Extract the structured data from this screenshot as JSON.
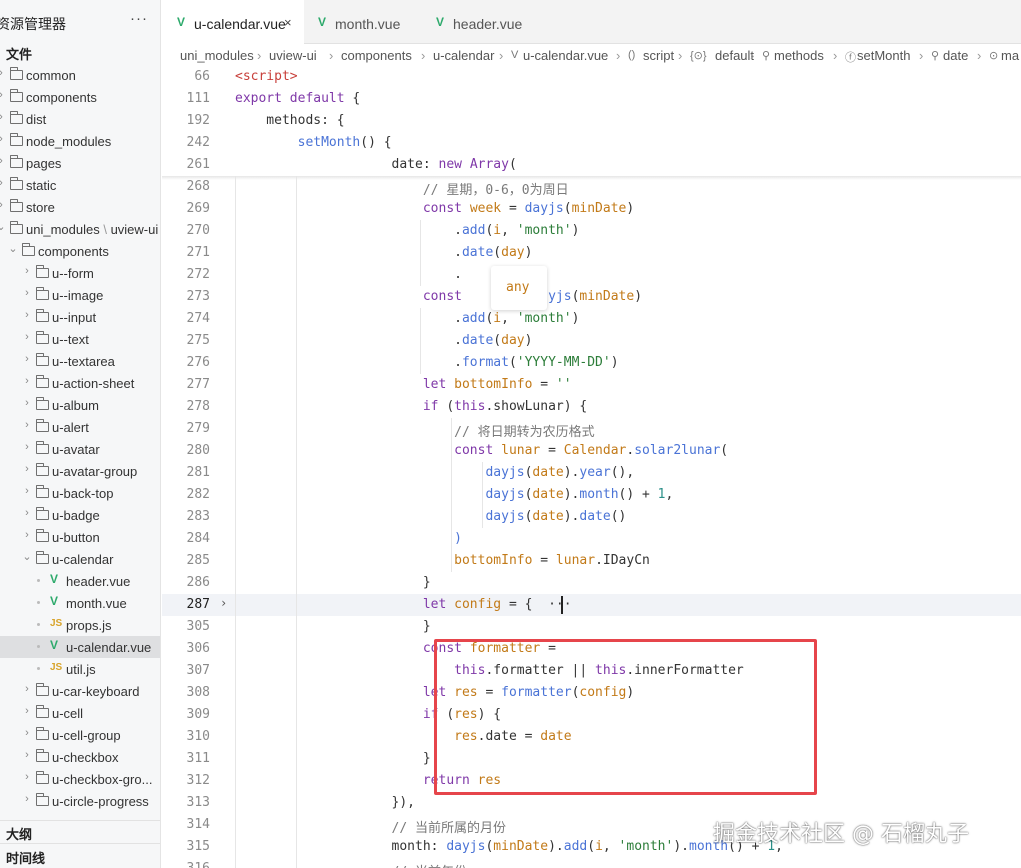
{
  "sidebar": {
    "title": "资源管理器",
    "more": "···",
    "section_files": "文件",
    "items": [
      {
        "label": "common",
        "depth": 0,
        "type": "folder"
      },
      {
        "label": "components",
        "depth": 0,
        "type": "folder"
      },
      {
        "label": "dist",
        "depth": 0,
        "type": "folder"
      },
      {
        "label": "node_modules",
        "depth": 0,
        "type": "folder"
      },
      {
        "label": "pages",
        "depth": 0,
        "type": "folder"
      },
      {
        "label": "static",
        "depth": 0,
        "type": "folder"
      },
      {
        "label": "store",
        "depth": 0,
        "type": "folder"
      },
      {
        "label": "uni_modules",
        "label2": "uview-ui",
        "depth": 0,
        "type": "folder-open"
      },
      {
        "label": "components",
        "depth": 1,
        "type": "folder-open"
      },
      {
        "label": "u--form",
        "depth": 2,
        "type": "folder"
      },
      {
        "label": "u--image",
        "depth": 2,
        "type": "folder"
      },
      {
        "label": "u--input",
        "depth": 2,
        "type": "folder"
      },
      {
        "label": "u--text",
        "depth": 2,
        "type": "folder"
      },
      {
        "label": "u--textarea",
        "depth": 2,
        "type": "folder"
      },
      {
        "label": "u-action-sheet",
        "depth": 2,
        "type": "folder"
      },
      {
        "label": "u-album",
        "depth": 2,
        "type": "folder"
      },
      {
        "label": "u-alert",
        "depth": 2,
        "type": "folder"
      },
      {
        "label": "u-avatar",
        "depth": 2,
        "type": "folder"
      },
      {
        "label": "u-avatar-group",
        "depth": 2,
        "type": "folder"
      },
      {
        "label": "u-back-top",
        "depth": 2,
        "type": "folder"
      },
      {
        "label": "u-badge",
        "depth": 2,
        "type": "folder"
      },
      {
        "label": "u-button",
        "depth": 2,
        "type": "folder"
      },
      {
        "label": "u-calendar",
        "depth": 2,
        "type": "folder-open"
      },
      {
        "label": "header.vue",
        "depth": 3,
        "type": "vue"
      },
      {
        "label": "month.vue",
        "depth": 3,
        "type": "vue"
      },
      {
        "label": "props.js",
        "depth": 3,
        "type": "js"
      },
      {
        "label": "u-calendar.vue",
        "depth": 3,
        "type": "vue",
        "selected": true
      },
      {
        "label": "util.js",
        "depth": 3,
        "type": "js"
      },
      {
        "label": "u-car-keyboard",
        "depth": 2,
        "type": "folder"
      },
      {
        "label": "u-cell",
        "depth": 2,
        "type": "folder"
      },
      {
        "label": "u-cell-group",
        "depth": 2,
        "type": "folder"
      },
      {
        "label": "u-checkbox",
        "depth": 2,
        "type": "folder"
      },
      {
        "label": "u-checkbox-gro...",
        "depth": 2,
        "type": "folder"
      },
      {
        "label": "u-circle-progress",
        "depth": 2,
        "type": "folder"
      }
    ],
    "outline_label": "大纲",
    "timeline_label": "时间线"
  },
  "tabs": [
    {
      "label": "u-calendar.vue",
      "active": true,
      "close": "×"
    },
    {
      "label": "month.vue",
      "active": false
    },
    {
      "label": "header.vue",
      "active": false
    }
  ],
  "breadcrumb": {
    "parts": [
      "uni_modules",
      "uview-ui",
      "components",
      "u-calendar",
      "u-calendar.vue",
      "script",
      "default",
      "methods",
      "setMonth",
      "date",
      "ma"
    ],
    "icons": [
      "",
      "",
      "",
      "",
      "V",
      "()",
      "{⊙}",
      "⚲",
      "ⓕ",
      "⚲",
      "⊙"
    ]
  },
  "code": {
    "hover_type": "any",
    "lines": [
      {
        "num": "66",
        "tokens": [
          [
            "t",
            "<script>"
          ]
        ]
      },
      {
        "num": "111",
        "tokens": [
          [
            "k",
            "export"
          ],
          [
            "p",
            " "
          ],
          [
            "k",
            "default"
          ],
          [
            "p",
            " {"
          ]
        ]
      },
      {
        "num": "192",
        "tokens": [
          [
            "p",
            "    methods: {"
          ]
        ]
      },
      {
        "num": "242",
        "tokens": [
          [
            "p",
            "        "
          ],
          [
            "f",
            "setMonth"
          ],
          [
            "p",
            "() {"
          ]
        ]
      },
      {
        "num": "261",
        "tokens": [
          [
            "p",
            "                    date: "
          ],
          [
            "k",
            "new"
          ],
          [
            "p",
            " "
          ],
          [
            "k",
            "Array"
          ],
          [
            "p",
            "("
          ]
        ]
      },
      {
        "num": "268",
        "tokens": [
          [
            "p",
            "                        "
          ],
          [
            "c",
            "// 星期，0-6，0为周日"
          ]
        ]
      },
      {
        "num": "269",
        "tokens": [
          [
            "p",
            "                        "
          ],
          [
            "k",
            "const"
          ],
          [
            "p",
            " "
          ],
          [
            "v",
            "week"
          ],
          [
            "p",
            " = "
          ],
          [
            "f",
            "dayjs"
          ],
          [
            "p",
            "("
          ],
          [
            "v",
            "minDate"
          ],
          [
            "p",
            ")"
          ]
        ]
      },
      {
        "num": "270",
        "tokens": [
          [
            "p",
            "                            ."
          ],
          [
            "f",
            "add"
          ],
          [
            "p",
            "("
          ],
          [
            "v",
            "i"
          ],
          [
            "p",
            ", "
          ],
          [
            "s",
            "'month'"
          ],
          [
            "p",
            ")"
          ]
        ]
      },
      {
        "num": "271",
        "tokens": [
          [
            "p",
            "                            ."
          ],
          [
            "f",
            "date"
          ],
          [
            "p",
            "("
          ],
          [
            "v",
            "day"
          ],
          [
            "p",
            ")"
          ]
        ]
      },
      {
        "num": "272",
        "tokens": [
          [
            "p",
            "                            ."
          ]
        ]
      },
      {
        "num": "273",
        "tokens": [
          [
            "p",
            "                        "
          ],
          [
            "k",
            "const"
          ],
          [
            "p",
            "         "
          ],
          [
            "f",
            "dayjs"
          ],
          [
            "p",
            "("
          ],
          [
            "v",
            "minDate"
          ],
          [
            "p",
            ")"
          ]
        ]
      },
      {
        "num": "274",
        "tokens": [
          [
            "p",
            "                            ."
          ],
          [
            "f",
            "add"
          ],
          [
            "p",
            "("
          ],
          [
            "v",
            "i"
          ],
          [
            "p",
            ", "
          ],
          [
            "s",
            "'month'"
          ],
          [
            "p",
            ")"
          ]
        ]
      },
      {
        "num": "275",
        "tokens": [
          [
            "p",
            "                            ."
          ],
          [
            "f",
            "date"
          ],
          [
            "p",
            "("
          ],
          [
            "v",
            "day"
          ],
          [
            "p",
            ")"
          ]
        ]
      },
      {
        "num": "276",
        "tokens": [
          [
            "p",
            "                            ."
          ],
          [
            "f",
            "format"
          ],
          [
            "p",
            "("
          ],
          [
            "s",
            "'YYYY-MM-DD'"
          ],
          [
            "p",
            ")"
          ]
        ]
      },
      {
        "num": "277",
        "tokens": [
          [
            "p",
            "                        "
          ],
          [
            "k",
            "let"
          ],
          [
            "p",
            " "
          ],
          [
            "v",
            "bottomInfo"
          ],
          [
            "p",
            " = "
          ],
          [
            "s",
            "''"
          ]
        ]
      },
      {
        "num": "278",
        "tokens": [
          [
            "p",
            "                        "
          ],
          [
            "k",
            "if"
          ],
          [
            "p",
            " ("
          ],
          [
            "k",
            "this"
          ],
          [
            "p",
            ".showLunar) {"
          ]
        ]
      },
      {
        "num": "279",
        "tokens": [
          [
            "p",
            "                            "
          ],
          [
            "c",
            "// 将日期转为农历格式"
          ]
        ]
      },
      {
        "num": "280",
        "tokens": [
          [
            "p",
            "                            "
          ],
          [
            "k",
            "const"
          ],
          [
            "p",
            " "
          ],
          [
            "v",
            "lunar"
          ],
          [
            "p",
            " = "
          ],
          [
            "v",
            "Calendar"
          ],
          [
            "p",
            "."
          ],
          [
            "f",
            "solar2lunar"
          ],
          [
            "p",
            "("
          ]
        ]
      },
      {
        "num": "281",
        "tokens": [
          [
            "p",
            "                                "
          ],
          [
            "f",
            "dayjs"
          ],
          [
            "p",
            "("
          ],
          [
            "v",
            "date"
          ],
          [
            "p",
            ")."
          ],
          [
            "f",
            "year"
          ],
          [
            "p",
            "(),"
          ]
        ]
      },
      {
        "num": "282",
        "tokens": [
          [
            "p",
            "                                "
          ],
          [
            "f",
            "dayjs"
          ],
          [
            "p",
            "("
          ],
          [
            "v",
            "date"
          ],
          [
            "p",
            ")."
          ],
          [
            "f",
            "month"
          ],
          [
            "p",
            "() + "
          ],
          [
            "n",
            "1"
          ],
          [
            "p",
            ","
          ]
        ]
      },
      {
        "num": "283",
        "tokens": [
          [
            "p",
            "                                "
          ],
          [
            "f",
            "dayjs"
          ],
          [
            "p",
            "("
          ],
          [
            "v",
            "date"
          ],
          [
            "p",
            ")."
          ],
          [
            "f",
            "date"
          ],
          [
            "p",
            "()"
          ]
        ]
      },
      {
        "num": "284",
        "tokens": [
          [
            "p",
            "                            "
          ],
          [
            "f",
            ")"
          ]
        ]
      },
      {
        "num": "285",
        "tokens": [
          [
            "p",
            "                            "
          ],
          [
            "v",
            "bottomInfo"
          ],
          [
            "p",
            " = "
          ],
          [
            "v",
            "lunar"
          ],
          [
            "p",
            ".IDayCn"
          ]
        ]
      },
      {
        "num": "286",
        "tokens": [
          [
            "p",
            "                        }"
          ]
        ]
      },
      {
        "num": "287",
        "tokens": [
          [
            "p",
            "                        "
          ],
          [
            "k",
            "let"
          ],
          [
            "p",
            " "
          ],
          [
            "v",
            "config"
          ],
          [
            "p",
            " = {  ···"
          ]
        ],
        "current": true
      },
      {
        "num": "305",
        "tokens": [
          [
            "p",
            "                        }"
          ]
        ]
      },
      {
        "num": "306",
        "tokens": [
          [
            "p",
            "                        "
          ],
          [
            "k",
            "const"
          ],
          [
            "p",
            " "
          ],
          [
            "v",
            "formatter"
          ],
          [
            "p",
            " ="
          ]
        ]
      },
      {
        "num": "307",
        "tokens": [
          [
            "p",
            "                            "
          ],
          [
            "k",
            "this"
          ],
          [
            "p",
            ".formatter || "
          ],
          [
            "k",
            "this"
          ],
          [
            "p",
            ".innerFormatter"
          ]
        ]
      },
      {
        "num": "308",
        "tokens": [
          [
            "p",
            "                        "
          ],
          [
            "k",
            "let"
          ],
          [
            "p",
            " "
          ],
          [
            "v",
            "res"
          ],
          [
            "p",
            " = "
          ],
          [
            "f",
            "formatter"
          ],
          [
            "p",
            "("
          ],
          [
            "v",
            "config"
          ],
          [
            "p",
            ")"
          ]
        ]
      },
      {
        "num": "309",
        "tokens": [
          [
            "p",
            "                        "
          ],
          [
            "k",
            "if"
          ],
          [
            "p",
            " ("
          ],
          [
            "v",
            "res"
          ],
          [
            "p",
            ") {"
          ]
        ]
      },
      {
        "num": "310",
        "tokens": [
          [
            "p",
            "                            "
          ],
          [
            "v",
            "res"
          ],
          [
            "p",
            ".date = "
          ],
          [
            "v",
            "date"
          ]
        ]
      },
      {
        "num": "311",
        "tokens": [
          [
            "p",
            "                        }"
          ]
        ]
      },
      {
        "num": "312",
        "tokens": [
          [
            "p",
            "                        "
          ],
          [
            "k",
            "return"
          ],
          [
            "p",
            " "
          ],
          [
            "v",
            "res"
          ]
        ]
      },
      {
        "num": "313",
        "tokens": [
          [
            "p",
            "                    }),"
          ]
        ]
      },
      {
        "num": "314",
        "tokens": [
          [
            "p",
            "                    "
          ],
          [
            "c",
            "// 当前所属的月份"
          ]
        ]
      },
      {
        "num": "315",
        "tokens": [
          [
            "p",
            "                    month: "
          ],
          [
            "f",
            "dayjs"
          ],
          [
            "p",
            "("
          ],
          [
            "v",
            "minDate"
          ],
          [
            "p",
            ")."
          ],
          [
            "f",
            "add"
          ],
          [
            "p",
            "("
          ],
          [
            "v",
            "i"
          ],
          [
            "p",
            ", "
          ],
          [
            "s",
            "'month'"
          ],
          [
            "p",
            ")."
          ],
          [
            "f",
            "month"
          ],
          [
            "p",
            "() + "
          ],
          [
            "n",
            "1"
          ],
          [
            "p",
            ","
          ]
        ]
      },
      {
        "num": "316",
        "tokens": [
          [
            "p",
            "                    "
          ],
          [
            "c",
            "// 当前年份"
          ]
        ]
      }
    ]
  },
  "watermark": "掘金技术社区 @ 石榴丸子",
  "colors": {
    "keyword": "#7f38a8",
    "tag": "#c8403b",
    "function": "#4a73d6",
    "variable": "#c27a18",
    "string": "#2c7d39",
    "comment": "#7a7a7a",
    "number": "#2a8f88",
    "vue_icon": "#2eaa6c",
    "js_icon": "#d8a42b",
    "highlight_box": "#e6454b"
  }
}
